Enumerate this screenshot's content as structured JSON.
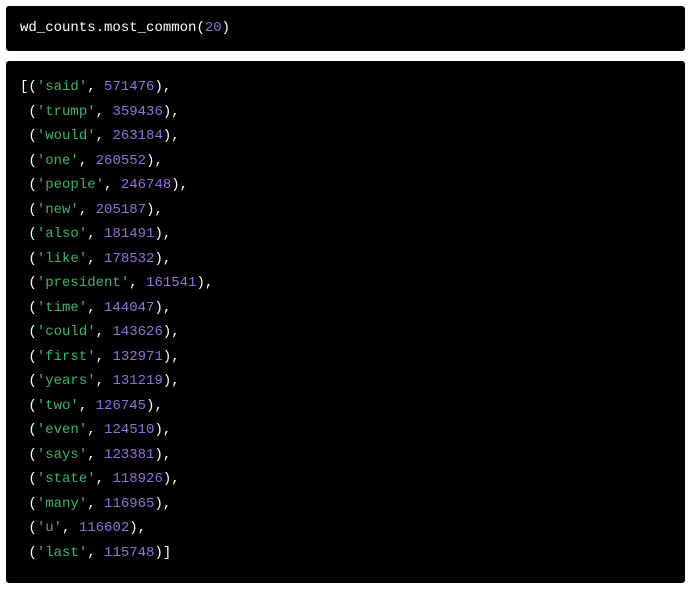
{
  "input": {
    "object": "wd_counts",
    "method": "most_common",
    "arg": "20"
  },
  "output": {
    "items": [
      {
        "word": "said",
        "count": "571476"
      },
      {
        "word": "trump",
        "count": "359436"
      },
      {
        "word": "would",
        "count": "263184"
      },
      {
        "word": "one",
        "count": "260552"
      },
      {
        "word": "people",
        "count": "246748"
      },
      {
        "word": "new",
        "count": "205187"
      },
      {
        "word": "also",
        "count": "181491"
      },
      {
        "word": "like",
        "count": "178532"
      },
      {
        "word": "president",
        "count": "161541"
      },
      {
        "word": "time",
        "count": "144047"
      },
      {
        "word": "could",
        "count": "143626"
      },
      {
        "word": "first",
        "count": "132971"
      },
      {
        "word": "years",
        "count": "131219"
      },
      {
        "word": "two",
        "count": "126745"
      },
      {
        "word": "even",
        "count": "124510"
      },
      {
        "word": "says",
        "count": "123381"
      },
      {
        "word": "state",
        "count": "118926"
      },
      {
        "word": "many",
        "count": "116965"
      },
      {
        "word": "u",
        "count": "116602"
      },
      {
        "word": "last",
        "count": "115748"
      }
    ]
  }
}
